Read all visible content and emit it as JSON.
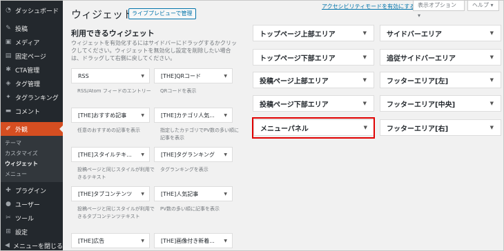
{
  "menu": {
    "dashboard": "ダッシュボード",
    "posts": "投稿",
    "media": "メディア",
    "pages": "固定ページ",
    "cta": "CTA管理",
    "tags": "タグ管理",
    "ranking": "タグランキング",
    "comments": "コメント",
    "appearance": "外観",
    "sub": {
      "theme": "テーマ",
      "customize": "カスタマイズ",
      "widgets": "ウィジェット",
      "menus": "メニュー"
    },
    "plugins": "プラグイン",
    "users": "ユーザー",
    "tools": "ツール",
    "settings": "設定",
    "collapse": "メニューを閉じる"
  },
  "header": {
    "title": "ウィジェット",
    "preview_button": "ライブプレビューで管理",
    "a11y_link": "アクセシビリティモードを有効にする",
    "screen_options": "表示オプション ▾",
    "help": "ヘルプ ▾"
  },
  "available": {
    "title": "利用できるウィジェット",
    "description": "ウィジェットを有効化するにはサイドバーにドラッグするかクリックしてください。ウィジェットを無効化し設定を削除したい場合は、ドラッグして右側に戻してください。",
    "widgets": [
      {
        "name": "RSS",
        "desc": "RSS/Atom フィードのエントリー"
      },
      {
        "name": "[THE]QRコード",
        "desc": "QRコードを表示"
      },
      {
        "name": "[THE]おすすめ記事",
        "desc": "任意のおすすめの記事を表示"
      },
      {
        "name": "[THE]カテゴリ人気...",
        "desc": "指定したカテゴリでPV数の多い順に記事を表示"
      },
      {
        "name": "[THE]スタイルテキ...",
        "desc": "投稿ページと同じスタイルが利用できるテキスト"
      },
      {
        "name": "[THE]タグランキング",
        "desc": "タグランキングを表示"
      },
      {
        "name": "[THE]タブコンテンツ",
        "desc": "投稿ページと同じスタイルが利用できるタブコンテンツテキスト"
      },
      {
        "name": "[THE]人気記事",
        "desc": "PV数の多い順に記事を表示"
      },
      {
        "name": "[THE]広告",
        "desc": ""
      },
      {
        "name": "[THE]画像付き新着...",
        "desc": ""
      }
    ]
  },
  "areas": {
    "left": [
      "トップページ上部エリア",
      "トップページ下部エリア",
      "投稿ページ上部エリア",
      "投稿ページ下部エリア",
      "メニューパネル"
    ],
    "right": [
      "サイドバーエリア",
      "追従サイドバーエリア",
      "フッターエリア[左]",
      "フッターエリア[中央]",
      "フッターエリア[右]"
    ]
  },
  "accent_colors": {
    "sidebar_bg": "#23282d",
    "active_menu": "#d54e21",
    "link": "#0073aa",
    "highlight_border": "#e00000"
  }
}
